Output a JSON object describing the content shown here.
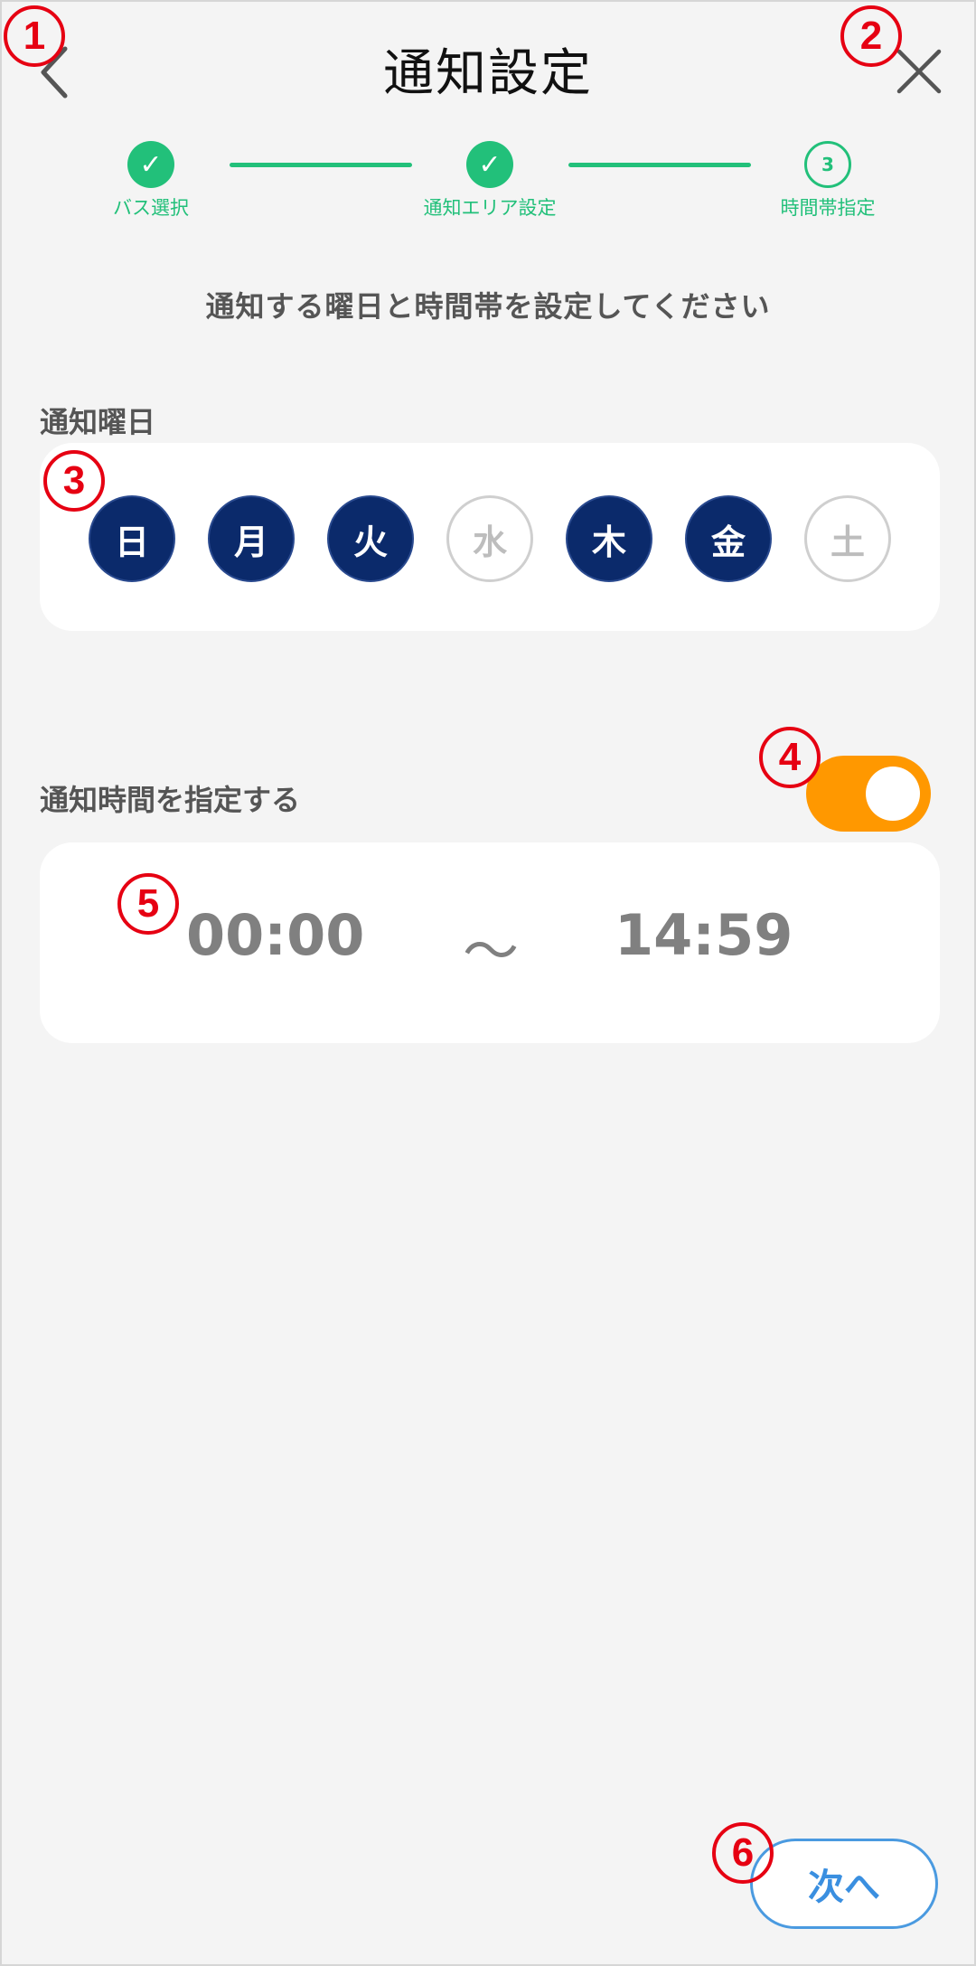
{
  "header": {
    "title": "通知設定",
    "back_icon": "chevron-left-icon",
    "close_icon": "close-icon"
  },
  "stepper": {
    "steps": [
      {
        "label": "バス選択",
        "status": "done",
        "mark": "✓"
      },
      {
        "label": "通知エリア設定",
        "status": "done",
        "mark": "✓"
      },
      {
        "label": "時間帯指定",
        "status": "current",
        "mark": "3"
      }
    ],
    "color": "#22c07a"
  },
  "instruction": "通知する曜日と時間帯を設定してください",
  "weekdays": {
    "label": "通知曜日",
    "days": [
      {
        "label": "日",
        "selected": true
      },
      {
        "label": "月",
        "selected": true
      },
      {
        "label": "火",
        "selected": true
      },
      {
        "label": "水",
        "selected": false
      },
      {
        "label": "木",
        "selected": true
      },
      {
        "label": "金",
        "selected": true
      },
      {
        "label": "土",
        "selected": false
      }
    ],
    "selected_color": "#0b2a6b"
  },
  "time_setting": {
    "label": "通知時間を指定する",
    "toggle_on": true,
    "toggle_color": "#ff9800",
    "start": "00:00",
    "separator": "～",
    "end": "14:59"
  },
  "footer": {
    "next_label": "次へ",
    "accent": "#3a8fe0"
  },
  "annotations": {
    "marker_color": "#e60012",
    "markers": [
      "1",
      "2",
      "3",
      "4",
      "5",
      "6"
    ]
  }
}
